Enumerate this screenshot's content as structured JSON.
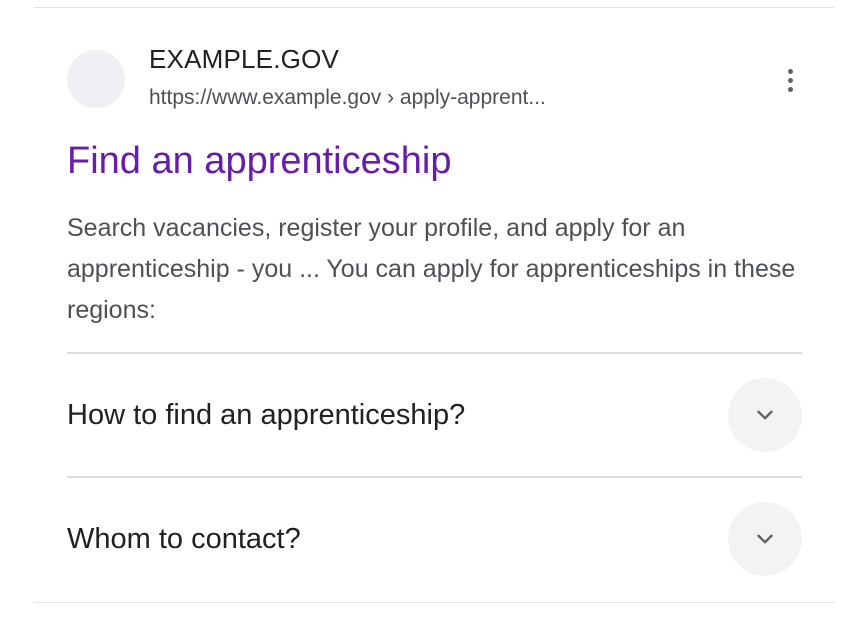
{
  "result": {
    "site_name": "EXAMPLE.GOV",
    "url": "https://www.example.gov › apply-apprent...",
    "title": "Find an apprenticeship",
    "snippet": "Search vacancies, register your profile, and apply for an apprenticeship - you ... You can apply for apprenticeships in these regions:",
    "title_color": "#681da8",
    "more_icon": "vertical-dots-icon"
  },
  "faq": {
    "items": [
      {
        "question": "How to find an apprenticeship?",
        "icon": "chevron-down-icon"
      },
      {
        "question": "Whom to contact?",
        "icon": "chevron-down-icon"
      }
    ]
  }
}
